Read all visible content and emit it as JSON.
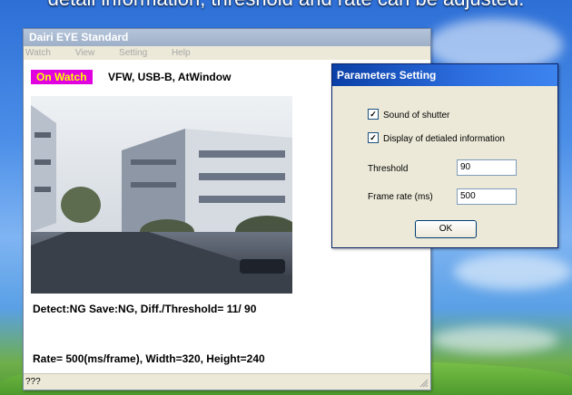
{
  "caption": "detail information,  threshold and rate can be adjusted.",
  "main_window": {
    "title": "Dairi EYE Standard",
    "menu": [
      "Watch",
      "View",
      "Setting",
      "Help"
    ],
    "watch_status": "On Watch",
    "device_info": "VFW,  USB-B,  AtWindow",
    "detect_line": "Detect:NG Save:NG, Diff./Threshold=   11/ 90",
    "rate_line": "Rate= 500(ms/frame), Width=320, Height=240",
    "status_text": "???"
  },
  "dialog": {
    "title": "Parameters Setting",
    "sound_of_shutter": {
      "label": "Sound of shutter",
      "checked": true
    },
    "display_detail": {
      "label": "Display of detialed information",
      "checked": true
    },
    "threshold": {
      "label": "Threshold",
      "value": "90"
    },
    "frame_rate": {
      "label": "Frame rate (ms)",
      "value": "500"
    },
    "ok_label": "OK"
  },
  "colors": {
    "watch_badge_bg": "#e000e0",
    "watch_badge_fg": "#ffff00",
    "dialog_title_bg": "#0a3fa6"
  }
}
